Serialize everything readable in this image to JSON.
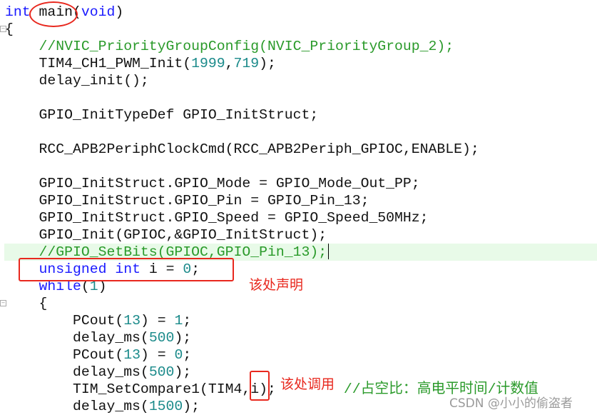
{
  "colors": {
    "keyword": "#1a1aff",
    "number": "#1a8a8a",
    "comment": "#2a9a2a",
    "text": "#111111",
    "highlight": "#e8fae8",
    "annotation": "#e8281e"
  },
  "code_lines": [
    [
      {
        "t": "int",
        "c": "kw"
      },
      {
        "t": " main",
        "c": "tx"
      },
      {
        "t": "(",
        "c": "tx"
      },
      {
        "t": "void",
        "c": "kw"
      },
      {
        "t": ")",
        "c": "tx"
      }
    ],
    [
      {
        "t": "{",
        "c": "tx"
      }
    ],
    [
      {
        "t": "    //NVIC_PriorityGroupConfig(NVIC_PriorityGroup_2);",
        "c": "cm"
      }
    ],
    [
      {
        "t": "    TIM4_CH1_PWM_Init(",
        "c": "tx"
      },
      {
        "t": "1999",
        "c": "num"
      },
      {
        "t": ",",
        "c": "tx"
      },
      {
        "t": "719",
        "c": "num"
      },
      {
        "t": ");",
        "c": "tx"
      }
    ],
    [
      {
        "t": "    delay_init();",
        "c": "tx"
      }
    ],
    [],
    [
      {
        "t": "    GPIO_InitTypeDef GPIO_InitStruct;",
        "c": "tx"
      }
    ],
    [],
    [
      {
        "t": "    RCC_APB2PeriphClockCmd(RCC_APB2Periph_GPIOC,ENABLE);",
        "c": "tx"
      }
    ],
    [],
    [
      {
        "t": "    GPIO_InitStruct.GPIO_Mode = GPIO_Mode_Out_PP;",
        "c": "tx"
      }
    ],
    [
      {
        "t": "    GPIO_InitStruct.GPIO_Pin = GPIO_Pin_13;",
        "c": "tx"
      }
    ],
    [
      {
        "t": "    GPIO_InitStruct.GPIO_Speed = GPIO_Speed_50MHz;",
        "c": "tx"
      }
    ],
    [
      {
        "t": "    GPIO_Init(GPIOC,&GPIO_InitStruct);",
        "c": "tx"
      }
    ],
    [
      {
        "t": "    //GPIO_SetBits(GPIOC,GPIO_Pin_13);",
        "c": "cm"
      }
    ],
    [
      {
        "t": "    unsigned",
        "c": "kw"
      },
      {
        "t": " ",
        "c": "tx"
      },
      {
        "t": "int",
        "c": "kw"
      },
      {
        "t": " i = ",
        "c": "tx"
      },
      {
        "t": "0",
        "c": "num"
      },
      {
        "t": ";",
        "c": "tx"
      }
    ],
    [
      {
        "t": "    while",
        "c": "kw"
      },
      {
        "t": "(",
        "c": "tx"
      },
      {
        "t": "1",
        "c": "num"
      },
      {
        "t": ")",
        "c": "tx"
      }
    ],
    [
      {
        "t": "    {",
        "c": "tx"
      }
    ],
    [
      {
        "t": "        PCout(",
        "c": "tx"
      },
      {
        "t": "13",
        "c": "num"
      },
      {
        "t": ") = ",
        "c": "tx"
      },
      {
        "t": "1",
        "c": "num"
      },
      {
        "t": ";",
        "c": "tx"
      }
    ],
    [
      {
        "t": "        delay_ms(",
        "c": "tx"
      },
      {
        "t": "500",
        "c": "num"
      },
      {
        "t": ");",
        "c": "tx"
      }
    ],
    [
      {
        "t": "        PCout(",
        "c": "tx"
      },
      {
        "t": "13",
        "c": "num"
      },
      {
        "t": ") = ",
        "c": "tx"
      },
      {
        "t": "0",
        "c": "num"
      },
      {
        "t": ";",
        "c": "tx"
      }
    ],
    [
      {
        "t": "        delay_ms(",
        "c": "tx"
      },
      {
        "t": "500",
        "c": "num"
      },
      {
        "t": ");",
        "c": "tx"
      }
    ],
    [
      {
        "t": "        TIM_SetCompare1(TIM4,i);     ",
        "c": "tx"
      },
      {
        "t": "   //占空比：高电平时间/计数值",
        "c": "cm"
      }
    ],
    [
      {
        "t": "        delay_ms(",
        "c": "tx"
      },
      {
        "t": "1500",
        "c": "num"
      },
      {
        "t": ");",
        "c": "tx"
      }
    ]
  ],
  "highlighted_line": 14,
  "fold_markers": [
    1,
    17
  ],
  "annotations": {
    "declare_note": "该处声明",
    "call_note": "该处调用"
  },
  "watermark": "CSDN @小小的偷盗者"
}
